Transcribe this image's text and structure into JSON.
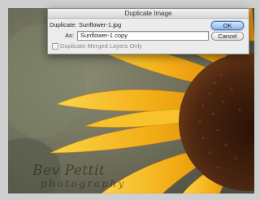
{
  "dialog": {
    "title": "Duplicate Image",
    "duplicate_label": "Duplicate:",
    "duplicate_value": "Sunflower-1.jpg",
    "as_label": "As:",
    "as_value": "Sunflower-1 copy",
    "merged_layers_label": "Duplicate Merged Layers Only",
    "merged_layers_checked": false,
    "ok_label": "OK",
    "cancel_label": "Cancel"
  },
  "photo": {
    "watermark_name": "Bev Pettit",
    "watermark_sub": "photography"
  },
  "colors": {
    "petal": "#f3ae16",
    "petal_light": "#fbd44a",
    "center": "#3a1a0c",
    "background": "#6f6f62",
    "ok_button": "#8bb6e8"
  }
}
